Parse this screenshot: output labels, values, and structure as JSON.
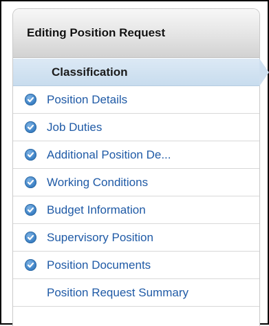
{
  "sidebar": {
    "title": "Editing Position Request",
    "active_item": "Classification",
    "items": [
      {
        "label": "Position Details",
        "checked": true
      },
      {
        "label": "Job Duties",
        "checked": true
      },
      {
        "label": "Additional Position De...",
        "checked": true
      },
      {
        "label": "Working Conditions",
        "checked": true
      },
      {
        "label": "Budget Information",
        "checked": true
      },
      {
        "label": "Supervisory Position",
        "checked": true
      },
      {
        "label": "Position Documents",
        "checked": true
      },
      {
        "label": "Position Request Summary",
        "checked": false
      }
    ]
  },
  "colors": {
    "link": "#1f5aa6",
    "check": "#3d82c6",
    "active_bg": "#cfe0f0"
  }
}
